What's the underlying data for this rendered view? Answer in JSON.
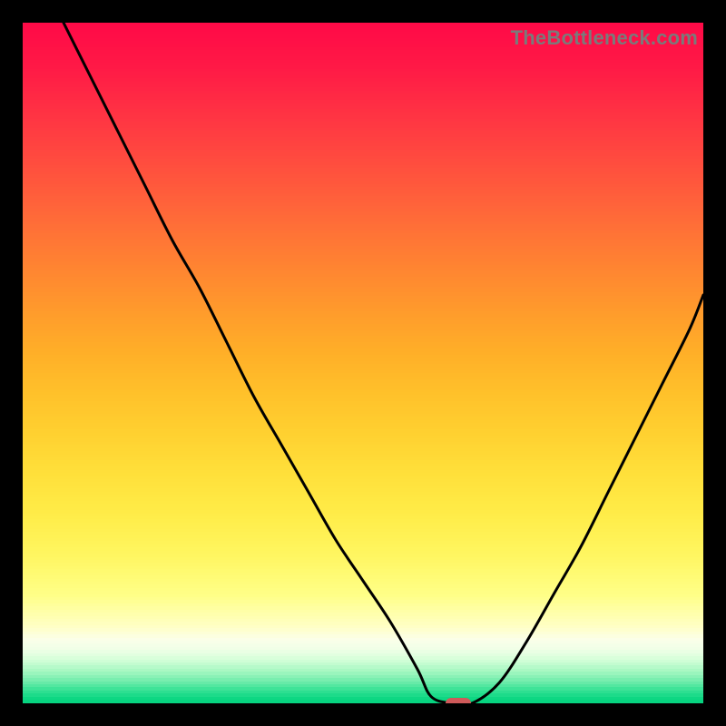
{
  "watermark": "TheBottleneck.com",
  "chart_data": {
    "type": "line",
    "title": "",
    "xlabel": "",
    "ylabel": "",
    "xlim": [
      0,
      100
    ],
    "ylim": [
      0,
      100
    ],
    "grid": false,
    "legend": false,
    "series": [
      {
        "name": "bottleneck-curve",
        "x": [
          6,
          10,
          14,
          18,
          22,
          26,
          30,
          34,
          38,
          42,
          46,
          50,
          54,
          58,
          60,
          63,
          66,
          70,
          74,
          78,
          82,
          86,
          90,
          94,
          98,
          100
        ],
        "y": [
          100,
          92,
          84,
          76,
          68,
          61,
          53,
          45,
          38,
          31,
          24,
          18,
          12,
          5,
          1,
          0,
          0,
          3,
          9,
          16,
          23,
          31,
          39,
          47,
          55,
          60
        ]
      }
    ],
    "marker": {
      "x": 64,
      "y": 0,
      "color": "#cf5a5a"
    },
    "background_gradient": {
      "stops": [
        {
          "pos": 0.0,
          "color": "#ff0a47"
        },
        {
          "pos": 0.06,
          "color": "#ff1846"
        },
        {
          "pos": 0.12,
          "color": "#ff2e44"
        },
        {
          "pos": 0.18,
          "color": "#ff4440"
        },
        {
          "pos": 0.24,
          "color": "#ff5a3c"
        },
        {
          "pos": 0.3,
          "color": "#ff7037"
        },
        {
          "pos": 0.36,
          "color": "#ff8531"
        },
        {
          "pos": 0.42,
          "color": "#ff9a2c"
        },
        {
          "pos": 0.48,
          "color": "#ffae28"
        },
        {
          "pos": 0.54,
          "color": "#ffc02a"
        },
        {
          "pos": 0.6,
          "color": "#ffd030"
        },
        {
          "pos": 0.66,
          "color": "#ffe03a"
        },
        {
          "pos": 0.72,
          "color": "#ffec48"
        },
        {
          "pos": 0.78,
          "color": "#fff660"
        },
        {
          "pos": 0.84,
          "color": "#ffff88"
        },
        {
          "pos": 0.885,
          "color": "#ffffc4"
        },
        {
          "pos": 0.905,
          "color": "#fbffea"
        },
        {
          "pos": 0.92,
          "color": "#efffe6"
        },
        {
          "pos": 0.935,
          "color": "#d2ffd8"
        },
        {
          "pos": 0.95,
          "color": "#a9f8c3"
        },
        {
          "pos": 0.965,
          "color": "#74edad"
        },
        {
          "pos": 0.978,
          "color": "#3be297"
        },
        {
          "pos": 0.99,
          "color": "#0fd884"
        },
        {
          "pos": 1.0,
          "color": "#00d17c"
        }
      ]
    }
  }
}
